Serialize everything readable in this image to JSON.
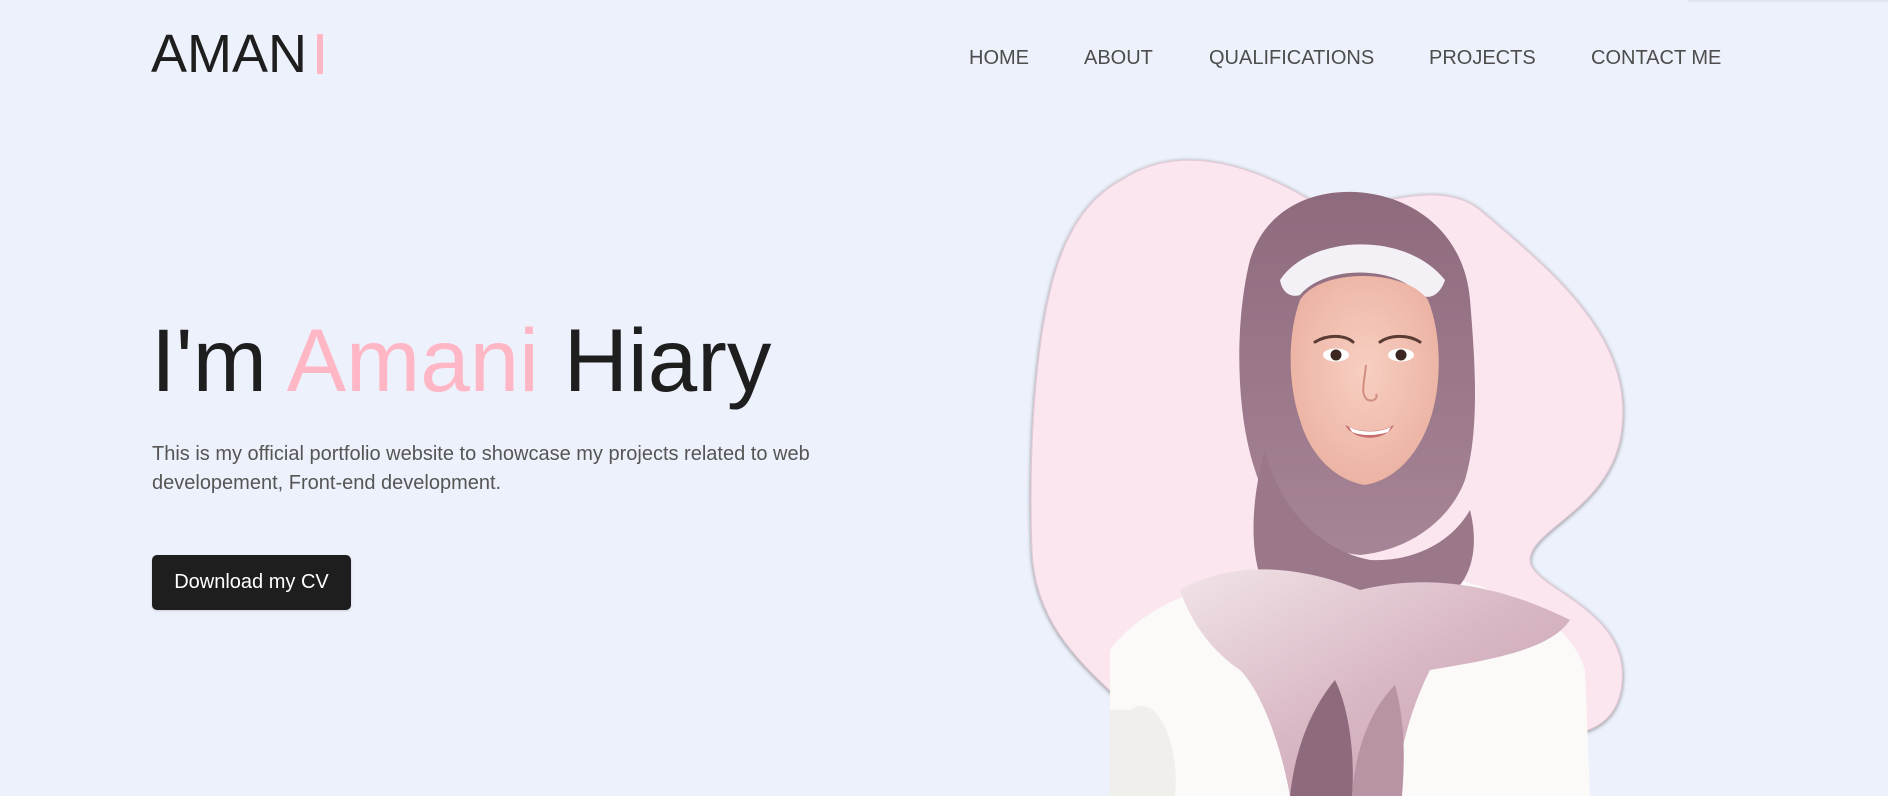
{
  "logo": {
    "text": "AMAN"
  },
  "nav": {
    "items": [
      "HOME",
      "ABOUT",
      "QUALIFICATIONS",
      "PROJECTS",
      "CONTACT ME"
    ]
  },
  "hero": {
    "title_prefix": "I'm",
    "title_accent": "Amani",
    "title_suffix": "Hiary",
    "description": "This is my official portfolio website to showcase my projects related to web developement, Front-end development.",
    "cta_label": "Download my CV"
  },
  "colors": {
    "background": "#edf1fb",
    "accent": "#ffb6c5",
    "text": "#1e1e1e",
    "button": "#1e1e1e"
  },
  "icons": {
    "logo_cursor": "typing-cursor-bar"
  }
}
